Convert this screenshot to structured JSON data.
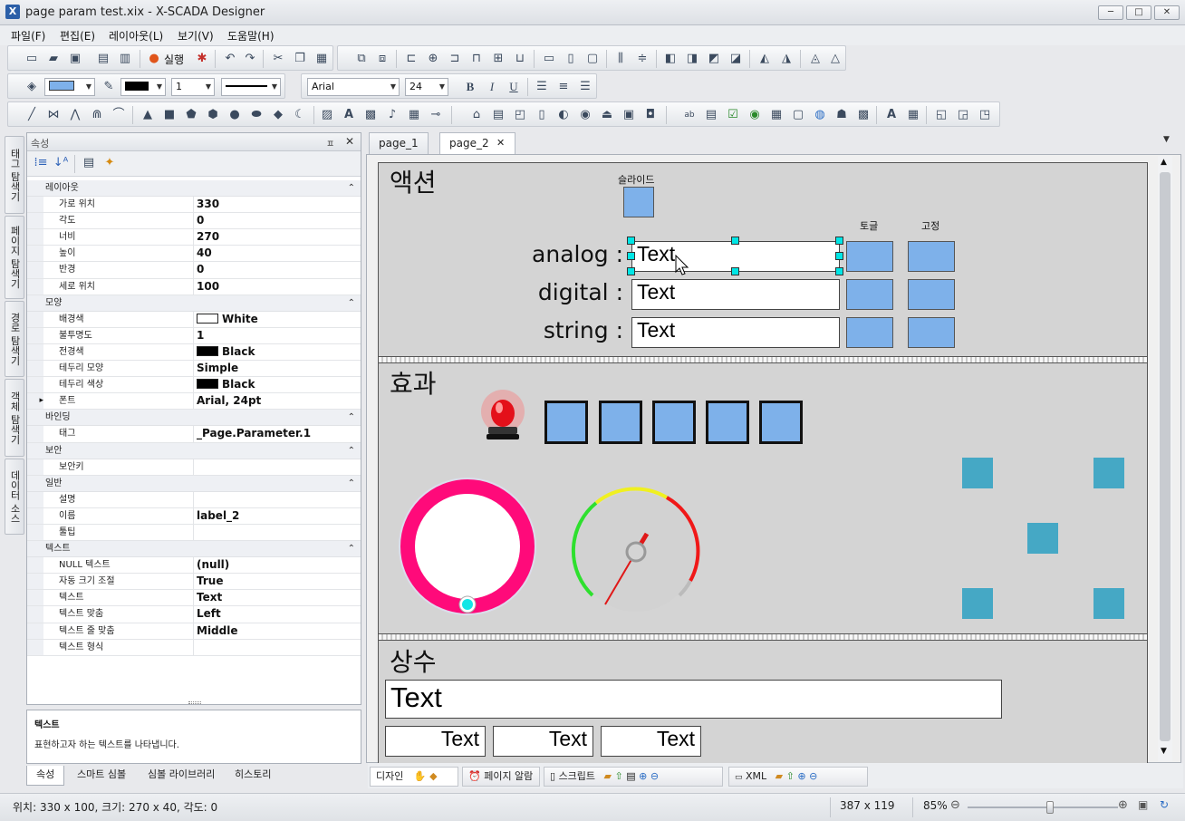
{
  "window": {
    "title": "page param test.xix - X-SCADA Designer",
    "app_icon": "X",
    "buttons": [
      "─",
      "□",
      "✕"
    ]
  },
  "menu": [
    "파일(F)",
    "편집(E)",
    "레이아웃(L)",
    "보기(V)",
    "도움말(H)"
  ],
  "toolbar": {
    "run_label": "실행",
    "line_width": "1",
    "font_name": "Arial",
    "font_size": "24"
  },
  "left_tabs": [
    "태그 탐색기",
    "페이지 탐색기",
    "경로 탐색기",
    "객체 탐색기",
    "데이터 소스"
  ],
  "properties": {
    "header": "속성",
    "pin": "ㅍ",
    "close": "✕",
    "sections": [
      {
        "name": "레이아웃",
        "rows": [
          {
            "k": "가로 위치",
            "v": "330"
          },
          {
            "k": "각도",
            "v": "0"
          },
          {
            "k": "너비",
            "v": "270"
          },
          {
            "k": "높이",
            "v": "40"
          },
          {
            "k": "반경",
            "v": "0"
          },
          {
            "k": "세로 위치",
            "v": "100"
          }
        ]
      },
      {
        "name": "모양",
        "rows": [
          {
            "k": "배경색",
            "v": "White",
            "swatch": "#ffffff"
          },
          {
            "k": "불투명도",
            "v": "1"
          },
          {
            "k": "전경색",
            "v": "Black",
            "swatch": "#000000"
          },
          {
            "k": "테두리 모양",
            "v": "Simple"
          },
          {
            "k": "테두리 색상",
            "v": "Black",
            "swatch": "#000000"
          },
          {
            "k": "폰트",
            "v": "Arial, 24pt",
            "expand": true
          }
        ]
      },
      {
        "name": "바인딩",
        "rows": [
          {
            "k": "태그",
            "v": "_Page.Parameter.1"
          }
        ]
      },
      {
        "name": "보안",
        "rows": [
          {
            "k": "보안키",
            "v": ""
          }
        ]
      },
      {
        "name": "일반",
        "rows": [
          {
            "k": "설명",
            "v": ""
          },
          {
            "k": "이름",
            "v": "label_2"
          },
          {
            "k": "툴팁",
            "v": ""
          }
        ]
      },
      {
        "name": "텍스트",
        "rows": [
          {
            "k": "NULL 텍스트",
            "v": "(null)"
          },
          {
            "k": "자동 크기 조절",
            "v": "True"
          },
          {
            "k": "텍스트",
            "v": "Text"
          },
          {
            "k": "텍스트 맞춤",
            "v": "Left"
          },
          {
            "k": "텍스트 줄 맞춤",
            "v": "Middle"
          },
          {
            "k": "텍스트 형식",
            "v": ""
          }
        ]
      }
    ],
    "description_title": "텍스트",
    "description_text": "표현하고자 하는 텍스트를 나타냅니다."
  },
  "bottom_tabs": [
    "속성",
    "스마트 심볼",
    "심볼 라이브러리",
    "히스토리"
  ],
  "page_tabs": [
    "page_1",
    "page_2"
  ],
  "canvas": {
    "section1": "액션",
    "slide_label": "슬라이드",
    "toggle_label": "토글",
    "fixed_label": "고정",
    "rows": [
      {
        "label": "analog :",
        "value": "Text"
      },
      {
        "label": "digital :",
        "value": "Text"
      },
      {
        "label": "string :",
        "value": "Text"
      }
    ],
    "section2": "효과",
    "section3": "상수",
    "const_big": "Text",
    "const_small": [
      "Text",
      "Text",
      "Text"
    ]
  },
  "bottom_toolbar": {
    "design": "디자인",
    "page_alarm": "페이지 알람",
    "script": "스크립트",
    "xml": "XML"
  },
  "status": {
    "position": "위치: 330 x 100, 크기: 270 x 40, 각도: 0",
    "size": "387 x 119",
    "zoom": "85%",
    "zoom_level": 0.55
  }
}
